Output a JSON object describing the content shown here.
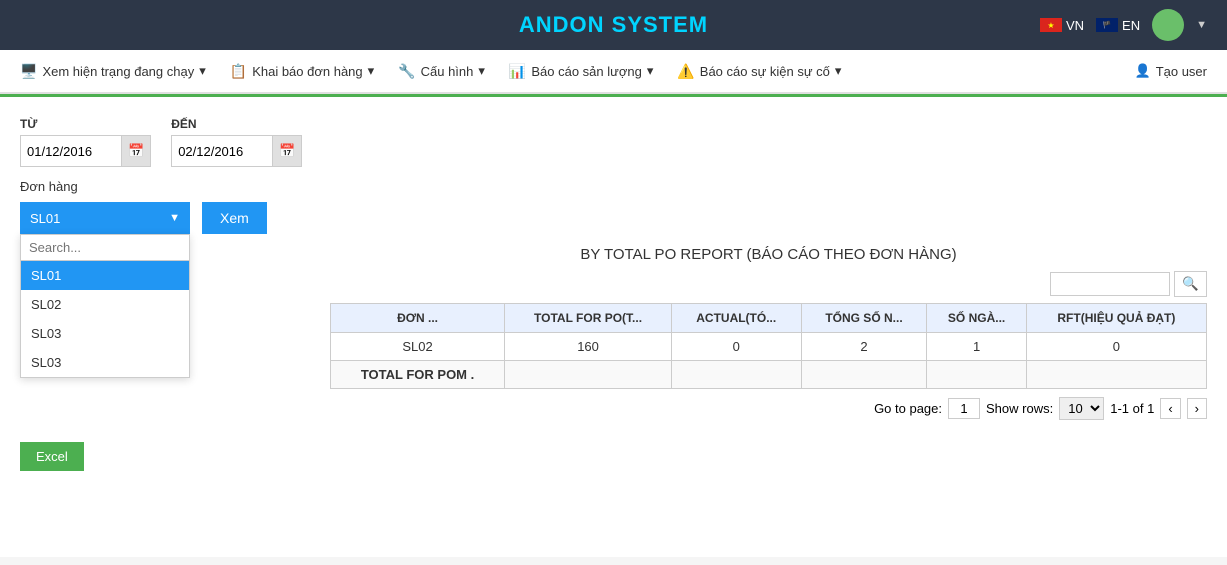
{
  "header": {
    "title": "ANDON SYSTEM",
    "lang_vn": "VN",
    "lang_en": "EN"
  },
  "navbar": {
    "items": [
      {
        "id": "xem-hien-trang",
        "icon": "🖥️",
        "label": "Xem hiện trạng đang chạy",
        "has_arrow": true
      },
      {
        "id": "khai-bao",
        "icon": "📋",
        "label": "Khai báo đơn hàng",
        "has_arrow": true
      },
      {
        "id": "cau-hinh",
        "icon": "🔧",
        "label": "Cấu hình",
        "has_arrow": true
      },
      {
        "id": "bao-cao-san-luong",
        "icon": "📊",
        "label": "Báo cáo sản lượng",
        "has_arrow": true
      },
      {
        "id": "bao-cao-su-kien",
        "icon": "⚠️",
        "label": "Báo cáo sự kiện sự cố",
        "has_arrow": true
      }
    ],
    "create_user": "Tạo user"
  },
  "form": {
    "label_from": "TỪ",
    "label_to": "ĐẾN",
    "date_from": "01/12/2016",
    "date_to": "02/12/2016",
    "don_hang_label": "Đơn hàng",
    "selected_value": "SL01",
    "search_placeholder": "Search...",
    "dropdown_items": [
      "SL01",
      "SL02",
      "SL03",
      "SL03"
    ],
    "xem_label": "Xem"
  },
  "report": {
    "title": "BY TOTAL PO REPORT (BÁO CÁO THEO ĐƠN HÀNG)",
    "table": {
      "columns": [
        "ĐƠN ...",
        "TOTAL FOR PO(T...",
        "ACTUAL(TÓ...",
        "TỔNG SỐ N...",
        "SỐ NGÀ...",
        "RFT(HIỆU QUẢ ĐẠT)"
      ],
      "rows": [
        {
          "don_hang": "SL02",
          "total_for_po": "160",
          "actual": "0",
          "tong_so": "2",
          "so_nga": "1",
          "rft": "0"
        }
      ],
      "total_row": {
        "label": "TOTAL FOR POM  .",
        "total_for_po": "",
        "actual": "",
        "tong_so": "",
        "so_nga": "",
        "rft": ""
      }
    },
    "pagination": {
      "go_to_page_label": "Go to page:",
      "page_value": "1",
      "show_rows_label": "Show rows:",
      "rows_value": "10",
      "range_label": "1-1 of 1"
    }
  },
  "excel_btn": "Excel"
}
